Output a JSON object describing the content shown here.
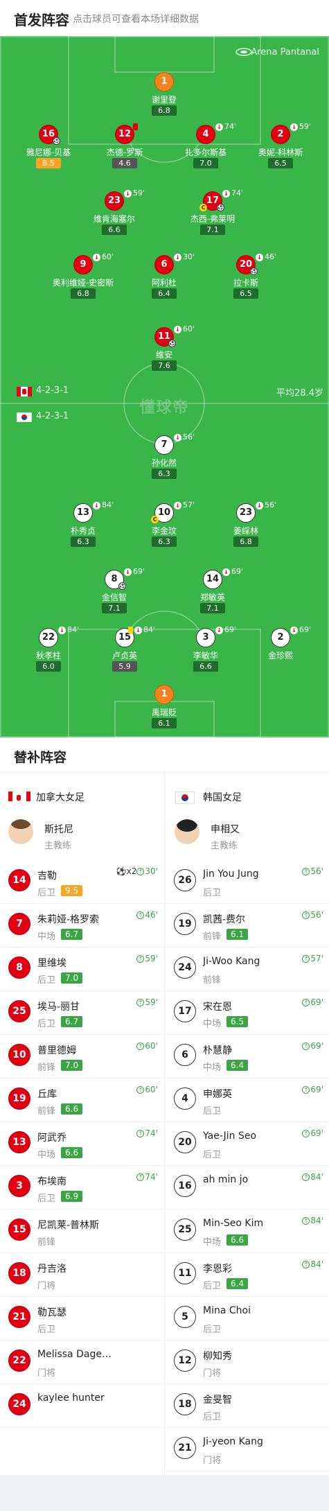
{
  "header": {
    "title": "首发阵容",
    "subtitle": "点击球员可查看本场详细数据"
  },
  "pitch": {
    "venue": "Arena Pantanal",
    "home_formation": "4-2-3-1",
    "away_formation": "4-2-3-1",
    "avg_age": "平均28.4岁",
    "watermark": "懂球帝"
  },
  "lineup_home": [
    {
      "num": "1",
      "name": "谢里登",
      "rating": "6.8",
      "kit": "gk"
    },
    {
      "num": "16",
      "name": "雅尼娜-贝基",
      "rating": "8.5",
      "kit": "red",
      "rating_style": "orange",
      "ball": true
    },
    {
      "num": "12",
      "name": "杰德-罗斯",
      "rating": "4.6",
      "kit": "red",
      "rating_style": "gray",
      "card": "red"
    },
    {
      "num": "4",
      "name": "扎多尔斯基",
      "rating": "7.0",
      "kit": "red",
      "sub": "74'"
    },
    {
      "num": "2",
      "name": "奥妮-科林斯",
      "rating": "6.5",
      "kit": "red",
      "sub": "59'"
    },
    {
      "num": "23",
      "name": "维肯海塞尔",
      "rating": "6.6",
      "kit": "red",
      "sub": "59'"
    },
    {
      "num": "17",
      "name": "杰西-弗莱明",
      "rating": "7.1",
      "kit": "red",
      "sub": "74'",
      "captain": true,
      "ball": true
    },
    {
      "num": "9",
      "name": "奥利维娅-史密斯",
      "rating": "6.8",
      "kit": "red",
      "sub": "60'"
    },
    {
      "num": "6",
      "name": "阿利杜",
      "rating": "6.4",
      "kit": "red",
      "sub": "30'"
    },
    {
      "num": "20",
      "name": "拉卡斯",
      "rating": "6.5",
      "kit": "red",
      "sub": "46'",
      "ball": true
    },
    {
      "num": "11",
      "name": "维安",
      "rating": "7.6",
      "kit": "red",
      "sub": "60'",
      "ball": true
    }
  ],
  "lineup_away": [
    {
      "num": "7",
      "name": "孙化然",
      "rating": "6.3",
      "kit": "white",
      "sub": "56'"
    },
    {
      "num": "13",
      "name": "朴秀贞",
      "rating": "6.3",
      "kit": "white",
      "sub": "84'"
    },
    {
      "num": "10",
      "name": "李金玟",
      "rating": "6.3",
      "kit": "white",
      "sub": "57'",
      "captain": true
    },
    {
      "num": "23",
      "name": "姜綵林",
      "rating": "6.8",
      "kit": "white",
      "sub": "56'"
    },
    {
      "num": "8",
      "name": "金信智",
      "rating": "7.1",
      "kit": "white",
      "sub": "69'",
      "ball": true
    },
    {
      "num": "14",
      "name": "郑敏英",
      "rating": "7.1",
      "kit": "white",
      "sub": "69'"
    },
    {
      "num": "22",
      "name": "秋孝柱",
      "rating": "6.0",
      "kit": "white",
      "sub": "84'"
    },
    {
      "num": "15",
      "name": "卢贞英",
      "rating": "5.9",
      "kit": "white",
      "sub": "84'",
      "card": "yellow",
      "rating_style": "gray"
    },
    {
      "num": "3",
      "name": "李敏华",
      "rating": "6.6",
      "kit": "white",
      "sub": "69'"
    },
    {
      "num": "2",
      "name": "金珍熙",
      "rating": "",
      "kit": "white",
      "sub": "69'"
    },
    {
      "num": "1",
      "name": "禹瑞贬",
      "rating": "6.1",
      "kit": "gk"
    }
  ],
  "subs": {
    "title": "替补阵容",
    "home": {
      "team": "加拿大女足",
      "coach": {
        "name": "斯托尼",
        "role": "主教练"
      },
      "players": [
        {
          "num": "14",
          "name": "吉勒",
          "pos": "后卫",
          "rating": "9.5",
          "rating_style": "orange",
          "event": "30'",
          "goals": "x2"
        },
        {
          "num": "7",
          "name": "朱莉娅-格罗索",
          "pos": "中场",
          "rating": "6.7",
          "event": "46'"
        },
        {
          "num": "8",
          "name": "里维埃",
          "pos": "后卫",
          "rating": "7.0",
          "event": "59'"
        },
        {
          "num": "25",
          "name": "埃马-丽甘",
          "pos": "后卫",
          "rating": "6.7",
          "event": "59'"
        },
        {
          "num": "10",
          "name": "普里德姆",
          "pos": "前锋",
          "rating": "7.0",
          "event": "60'"
        },
        {
          "num": "19",
          "name": "丘库",
          "pos": "前锋",
          "rating": "6.6",
          "event": "60'"
        },
        {
          "num": "13",
          "name": "阿武乔",
          "pos": "中场",
          "rating": "6.6",
          "event": "74'"
        },
        {
          "num": "3",
          "name": "布埃南",
          "pos": "后卫",
          "rating": "6.9",
          "event": "74'"
        },
        {
          "num": "15",
          "name": "尼凯莱-普林斯",
          "pos": "前锋",
          "rating": "",
          "event": ""
        },
        {
          "num": "18",
          "name": "丹吉洛",
          "pos": "门将",
          "rating": "",
          "event": ""
        },
        {
          "num": "21",
          "name": "勒瓦瑟",
          "pos": "后卫",
          "rating": "",
          "event": ""
        },
        {
          "num": "22",
          "name": "Melissa Dage…",
          "pos": "门将",
          "rating": "",
          "event": ""
        },
        {
          "num": "24",
          "name": "kaylee hunter",
          "pos": "",
          "rating": "",
          "event": ""
        }
      ]
    },
    "away": {
      "team": "韩国女足",
      "coach": {
        "name": "申相又",
        "role": "主教练"
      },
      "players": [
        {
          "num": "26",
          "name": "Jin You Jung",
          "pos": "后卫",
          "rating": "",
          "event": "56'"
        },
        {
          "num": "19",
          "name": "凯茜-费尔",
          "pos": "前锋",
          "rating": "6.1",
          "event": "56'"
        },
        {
          "num": "24",
          "name": "Ji-Woo Kang",
          "pos": "前锋",
          "rating": "",
          "event": "57'"
        },
        {
          "num": "17",
          "name": "宋在恩",
          "pos": "中场",
          "rating": "6.5",
          "event": "69'"
        },
        {
          "num": "6",
          "name": "朴慧静",
          "pos": "中场",
          "rating": "6.4",
          "event": "69'"
        },
        {
          "num": "4",
          "name": "申娜英",
          "pos": "后卫",
          "rating": "",
          "event": "69'"
        },
        {
          "num": "20",
          "name": "Yae-Jin Seo",
          "pos": "后卫",
          "rating": "",
          "event": "69'"
        },
        {
          "num": "16",
          "name": "ah min jo",
          "pos": "",
          "rating": "",
          "event": "84'"
        },
        {
          "num": "25",
          "name": "Min-Seo Kim",
          "pos": "中场",
          "rating": "6.6",
          "event": "84'"
        },
        {
          "num": "11",
          "name": "李恩彩",
          "pos": "后卫",
          "rating": "6.4",
          "event": "84'"
        },
        {
          "num": "5",
          "name": "Mina Choi",
          "pos": "后卫",
          "rating": "",
          "event": ""
        },
        {
          "num": "12",
          "name": "柳知秀",
          "pos": "门将",
          "rating": "",
          "event": ""
        },
        {
          "num": "18",
          "name": "金旻智",
          "pos": "后卫",
          "rating": "",
          "event": ""
        },
        {
          "num": "21",
          "name": "Ji-yeon Kang",
          "pos": "门将",
          "rating": "",
          "event": ""
        }
      ]
    }
  }
}
